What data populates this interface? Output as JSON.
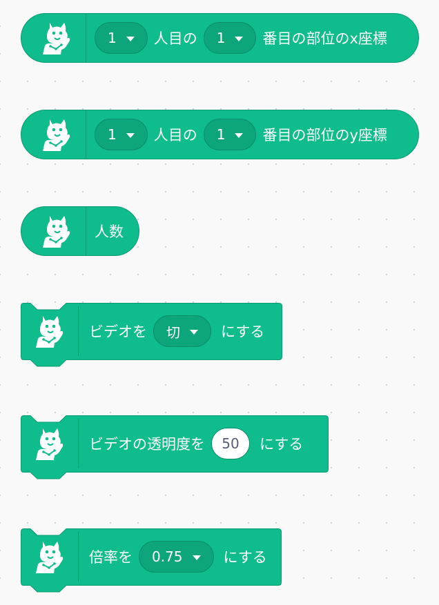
{
  "blocks": {
    "x_coord": {
      "person_value": "1",
      "label_person": "人目の",
      "part_value": "1",
      "label_coord": "番目の部位のx座標"
    },
    "y_coord": {
      "person_value": "1",
      "label_person": "人目の",
      "part_value": "1",
      "label_coord": "番目の部位のy座標"
    },
    "people_count": {
      "label": "人数"
    },
    "video": {
      "label_prefix": "ビデオを",
      "value": "切",
      "label_suffix": "にする"
    },
    "transparency": {
      "label_prefix": "ビデオの透明度を",
      "value": "50",
      "label_suffix": "にする"
    },
    "ratio": {
      "label_prefix": "倍率を",
      "value": "0.75",
      "label_suffix": "にする"
    }
  },
  "icon": "posenet-extension-icon",
  "colors": {
    "block_fill": "#0fbd8c",
    "block_border": "#0b9a72",
    "dropdown_fill": "#0da57a",
    "text": "#ffffff"
  }
}
